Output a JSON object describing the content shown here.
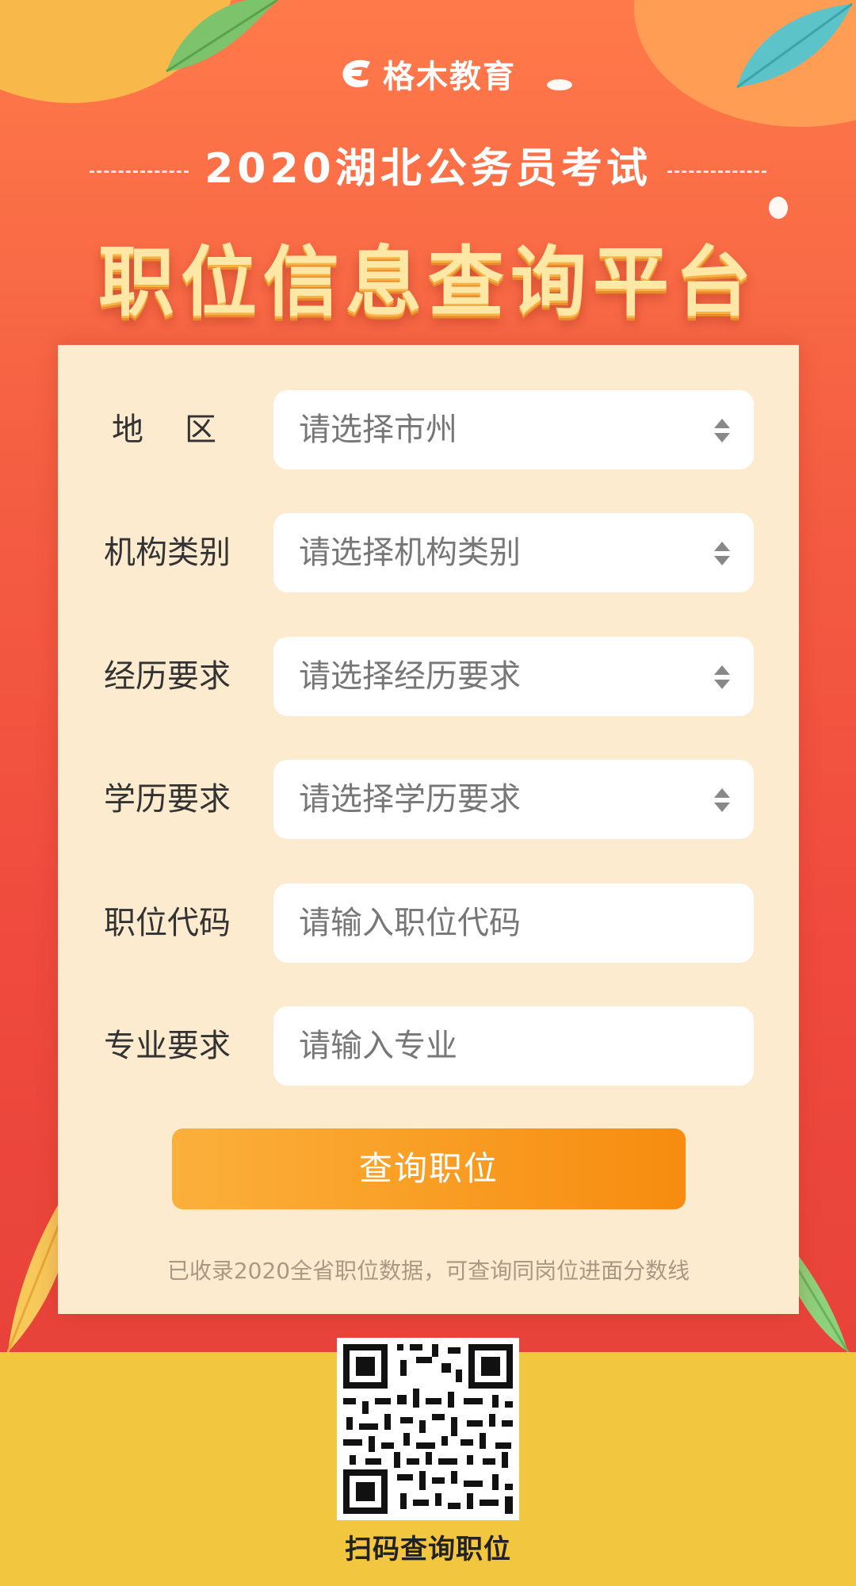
{
  "brand": {
    "name": "格木教育"
  },
  "header": {
    "subtitle": "2020湖北公务员考试",
    "title": "职位信息查询平台"
  },
  "form": {
    "fields": [
      {
        "label": "地区",
        "type": "select",
        "placeholder": "请选择市州"
      },
      {
        "label": "机构类别",
        "type": "select",
        "placeholder": "请选择机构类别"
      },
      {
        "label": "经历要求",
        "type": "select",
        "placeholder": "请选择经历要求"
      },
      {
        "label": "学历要求",
        "type": "select",
        "placeholder": "请选择学历要求"
      },
      {
        "label": "职位代码",
        "type": "input",
        "placeholder": "请输入职位代码"
      },
      {
        "label": "专业要求",
        "type": "input",
        "placeholder": "请输入专业"
      }
    ],
    "submit_label": "查询职位",
    "note": "已收录2020全省职位数据，可查询同岗位进面分数线"
  },
  "footer": {
    "qr_label": "扫码查询职位"
  },
  "colors": {
    "accent": "#f04a3e",
    "button": "#f78c0f",
    "footer_bg": "#f3c63f",
    "card_bg": "#fdebd0"
  },
  "icons": {
    "select_arrow": "up-down-arrows-icon",
    "logo": "gemu-logo-icon",
    "qr": "qr-code"
  }
}
